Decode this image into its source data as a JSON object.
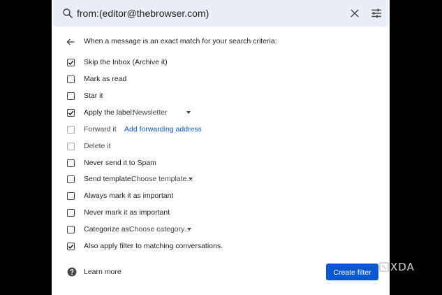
{
  "search": {
    "query": "from:(editor@thebrowser.com)"
  },
  "header": {
    "text": "When a message is an exact match for your search criteria:"
  },
  "options": [
    {
      "label": "Skip the Inbox (Archive it)",
      "checked": true
    },
    {
      "label": "Mark as read",
      "checked": false
    },
    {
      "label": "Star it",
      "checked": false
    },
    {
      "label": "Apply the label:",
      "checked": true,
      "select": "Newsletter"
    },
    {
      "label": "Forward it",
      "checked": false,
      "disabled": true,
      "link": "Add forwarding address"
    },
    {
      "label": "Delete it",
      "checked": false,
      "disabled": true
    },
    {
      "label": "Never send it to Spam",
      "checked": false
    },
    {
      "label": "Send template:",
      "checked": false,
      "select": "Choose template..."
    },
    {
      "label": "Always mark it as important",
      "checked": false
    },
    {
      "label": "Never mark it as important",
      "checked": false
    },
    {
      "label": "Categorize as:",
      "checked": false,
      "select": "Choose category..."
    },
    {
      "label": "Also apply filter to matching conversations.",
      "checked": true
    }
  ],
  "footer": {
    "learn_more": "Learn more",
    "create_filter": "Create filter"
  },
  "watermark": {
    "text": "XDA"
  },
  "icons": {
    "search": "search-icon",
    "close": "close-icon",
    "tune": "tune-icon",
    "back": "arrow-back-icon",
    "help": "help-icon",
    "check": "checkmark-icon"
  },
  "colors": {
    "accent": "#0b57d0",
    "search_bg": "#e9eef6",
    "text": "#1f1f1f"
  }
}
